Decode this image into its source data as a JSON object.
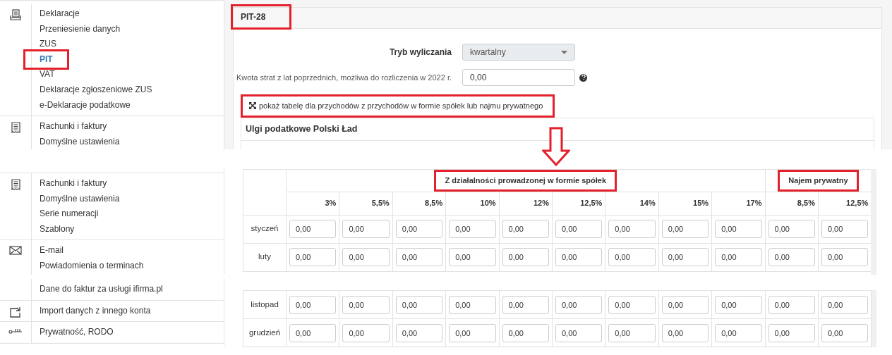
{
  "top": {
    "sidebar": {
      "groups": [
        {
          "items": [
            {
              "label": "Deklaracje",
              "selected": false,
              "highlighted": false
            },
            {
              "label": "Przeniesienie danych",
              "selected": false,
              "highlighted": false
            },
            {
              "label": "ZUS",
              "selected": false,
              "highlighted": false
            },
            {
              "label": "PIT",
              "selected": true,
              "highlighted": true
            },
            {
              "label": "VAT",
              "selected": false,
              "highlighted": false
            },
            {
              "label": "Deklaracje zgłoszeniowe ZUS",
              "selected": false,
              "highlighted": false
            },
            {
              "label": "e-Deklaracje podatkowe",
              "selected": false,
              "highlighted": false
            }
          ]
        },
        {
          "items": [
            {
              "label": "Rachunki i faktury",
              "selected": false,
              "highlighted": false
            },
            {
              "label": "Domyślne ustawienia",
              "selected": false,
              "highlighted": false
            }
          ]
        }
      ]
    },
    "panel": {
      "title": "PIT-28",
      "title_highlighted": true,
      "fields": [
        {
          "kind": "select",
          "label": "Tryb wyliczania",
          "value": "kwartalny"
        },
        {
          "kind": "input",
          "label": "Kwota strat z lat poprzednich, możliwa do rozliczenia w 2022 r.",
          "value": "0,00",
          "help": true
        }
      ],
      "toggle_link": {
        "text": "pokaż tabelę dla przychodów z przychodów w formie spółek lub najmu prywatnego",
        "highlighted": true
      },
      "section_title": "Ulgi podatkowe Polski Ład"
    }
  },
  "bottom": {
    "sidebar": {
      "segments": [
        [
          {
            "items": [
              {
                "label": "Rachunki i faktury",
                "selected": false
              },
              {
                "label": "Domyślne ustawienia",
                "selected": false
              },
              {
                "label": "Serie numeracji",
                "selected": false
              },
              {
                "label": "Szablony",
                "selected": false
              }
            ]
          },
          {
            "items": [
              {
                "label": "E-mail",
                "selected": false
              },
              {
                "label": "Powiadomienia o terminach",
                "selected": false
              }
            ]
          }
        ],
        [
          {
            "items": [
              {
                "label": "Dane do faktur za usługi ifirma.pl",
                "selected": false
              }
            ]
          },
          {
            "items": [
              {
                "label": "Import danych z innego konta",
                "selected": false
              }
            ]
          },
          {
            "items": [
              {
                "label": "Prywatność, RODO",
                "selected": false
              }
            ]
          }
        ]
      ]
    },
    "table": {
      "groups": [
        {
          "label": "Z działalności prowadzonej w formie spółek",
          "highlighted": true,
          "rates": [
            "3%",
            "5,5%",
            "8,5%",
            "10%",
            "12%",
            "12,5%",
            "14%",
            "15%",
            "17%"
          ]
        },
        {
          "label": "Najem prywatny",
          "highlighted": true,
          "rates": [
            "8,5%",
            "12,5%"
          ]
        }
      ],
      "segments": [
        [
          {
            "month": "styczeń",
            "values": [
              "0,00",
              "0,00",
              "0,00",
              "0,00",
              "0,00",
              "0,00",
              "0,00",
              "0,00",
              "0,00",
              "0,00",
              "0,00"
            ]
          },
          {
            "month": "luty",
            "values": [
              "0,00",
              "0,00",
              "0,00",
              "0,00",
              "0,00",
              "0,00",
              "0,00",
              "0,00",
              "0,00",
              "0,00",
              "0,00"
            ]
          }
        ],
        [
          {
            "month": "listopad",
            "values": [
              "0,00",
              "0,00",
              "0,00",
              "0,00",
              "0,00",
              "0,00",
              "0,00",
              "0,00",
              "0,00",
              "0,00",
              "0,00"
            ]
          },
          {
            "month": "grudzień",
            "values": [
              "0,00",
              "0,00",
              "0,00",
              "0,00",
              "0,00",
              "0,00",
              "0,00",
              "0,00",
              "0,00",
              "0,00",
              "0,00"
            ]
          }
        ]
      ]
    }
  }
}
